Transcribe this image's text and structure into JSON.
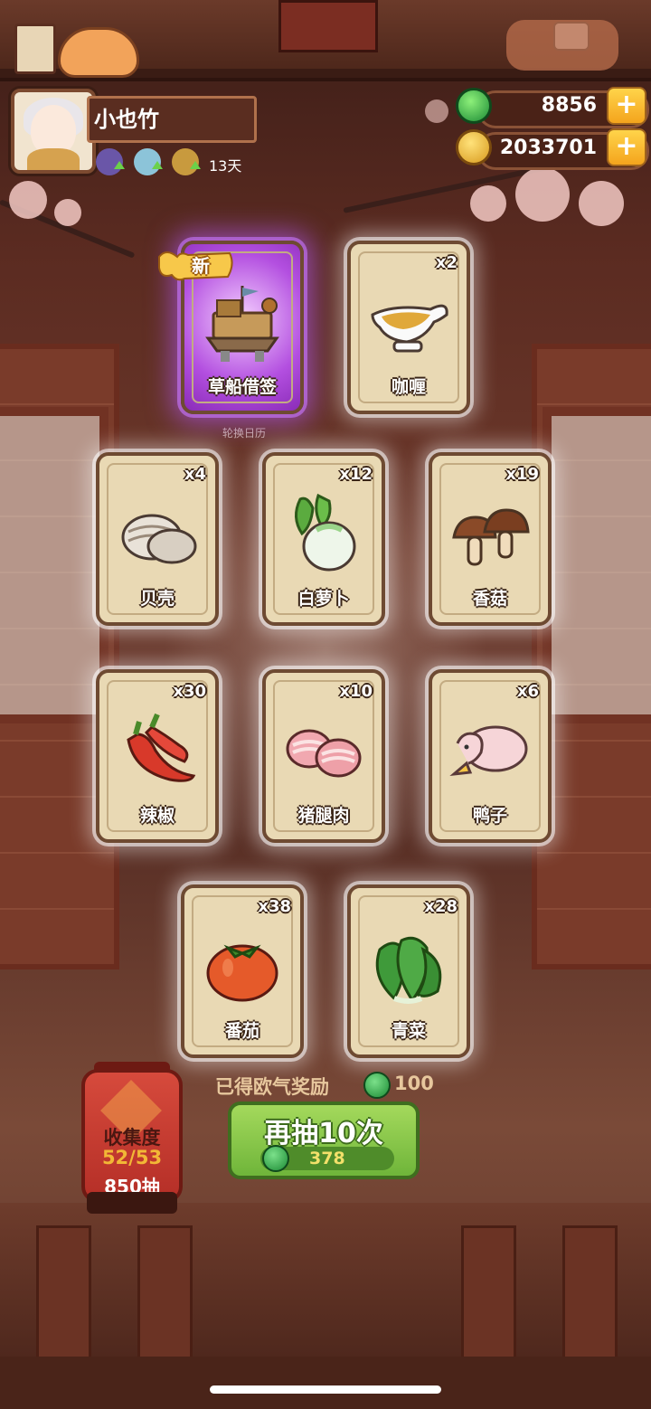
{
  "player": {
    "name": "小也竹",
    "days": "13天"
  },
  "currency": {
    "jade": "8856",
    "coins": "2033701"
  },
  "background": {
    "calendar_label": "轮换日历"
  },
  "new_badge": "新",
  "cards": [
    {
      "name": "草船借签",
      "count": "",
      "icon": "boat-icon"
    },
    {
      "name": "咖喱",
      "count": "x2",
      "icon": "curry-gravy-boat-icon"
    },
    {
      "name": "贝壳",
      "count": "x4",
      "icon": "clam-shell-icon"
    },
    {
      "name": "白萝卜",
      "count": "x12",
      "icon": "white-radish-icon"
    },
    {
      "name": "香菇",
      "count": "x19",
      "icon": "mushroom-icon"
    },
    {
      "name": "辣椒",
      "count": "x30",
      "icon": "chili-pepper-icon"
    },
    {
      "name": "猪腿肉",
      "count": "x10",
      "icon": "pork-leg-meat-icon"
    },
    {
      "name": "鸭子",
      "count": "x6",
      "icon": "duck-icon"
    },
    {
      "name": "番茄",
      "count": "x38",
      "icon": "tomato-icon"
    },
    {
      "name": "青菜",
      "count": "x28",
      "icon": "bok-choy-icon"
    }
  ],
  "reward": {
    "text": "已得欧气奖励",
    "value": "100"
  },
  "draw_button": {
    "label": "再抽10次",
    "cost": "378"
  },
  "collection": {
    "title": "收集度",
    "progress": "52/53",
    "draws": "850抽"
  },
  "colors": {
    "accent_green": "#6fb53a",
    "card_bg": "#e9d9b4",
    "special_purple": "#b34fe0",
    "lantern_red": "#c93a2f"
  }
}
